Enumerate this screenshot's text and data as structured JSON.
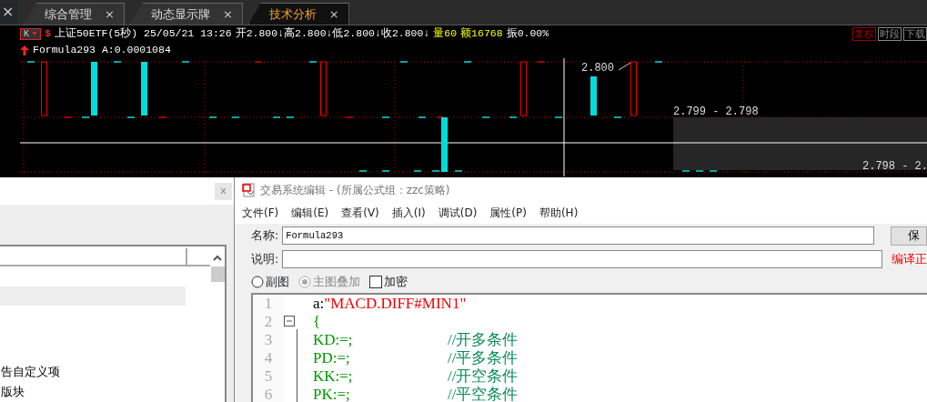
{
  "side_close": "×",
  "tabs": [
    {
      "label": "综合管理",
      "selected": false,
      "close": "×"
    },
    {
      "label": "动态显示牌",
      "selected": false,
      "close": "×"
    },
    {
      "label": "技术分析",
      "selected": true,
      "close": "×"
    }
  ],
  "quote": {
    "period_button": "K",
    "market_mark": "$",
    "segments": [
      {
        "text": "上证50ETF(5秒) 25/05/21 13:26"
      },
      {
        "text": "开2.800↓高2.800↓低2.800↓收2.800↓"
      },
      {
        "text": "量60",
        "color": "#ffff00"
      },
      {
        "text": "额16768",
        "color": "#ffff00"
      },
      {
        "text": "振0.00%"
      }
    ]
  },
  "indicator": {
    "text": "Formula293 A:0.0001084"
  },
  "chart_buttons": [
    {
      "label": "复权",
      "highlighted": true
    },
    {
      "label": "时段",
      "highlighted": false
    },
    {
      "label": "下载",
      "highlighted": false
    }
  ],
  "chart": {
    "price_label": "2.800",
    "range_labels": [
      "2.799 - 2.798",
      "2.798 - 2."
    ]
  },
  "left_panel": {
    "close_label": "x",
    "items": [
      "告自定义项",
      "版块"
    ]
  },
  "editor": {
    "title": "交易系统编辑 - (所属公式组：zzc策略)",
    "menu": [
      "文件(F)",
      "编辑(E)",
      "查看(V)",
      "插入(I)",
      "调试(D)",
      "属性(P)",
      "帮助(H)"
    ],
    "fields": [
      {
        "label": "名称:",
        "value": "Formula293"
      },
      {
        "label": "说明:"
      }
    ],
    "save_button": "保",
    "status": "编译正",
    "options": [
      {
        "kind": "radio",
        "label": "副图",
        "checked": false,
        "disabled": false
      },
      {
        "kind": "radio",
        "label": "主图叠加",
        "checked": true,
        "disabled": true
      },
      {
        "kind": "checkbox",
        "label": "加密",
        "checked": false,
        "disabled": false
      }
    ],
    "code_lines": [
      {
        "number": "1",
        "fold": false,
        "tokens": [
          {
            "text": "a:",
            "kind": "plain"
          },
          {
            "text": "\"MACD.DIFF#MIN1\"",
            "kind": "string"
          }
        ]
      },
      {
        "number": "2",
        "fold": true,
        "tokens": [
          {
            "text": "{",
            "kind": "code"
          }
        ]
      },
      {
        "number": "3",
        "fold": false,
        "tokens": [
          {
            "text": "KD:=;",
            "kind": "code"
          },
          {
            "text": "//开多条件",
            "kind": "comment"
          }
        ]
      },
      {
        "number": "4",
        "fold": false,
        "tokens": [
          {
            "text": "PD:=;",
            "kind": "code"
          },
          {
            "text": "//平多条件",
            "kind": "comment"
          }
        ]
      },
      {
        "number": "5",
        "fold": false,
        "tokens": [
          {
            "text": "KK:=;",
            "kind": "code"
          },
          {
            "text": "//开空条件",
            "kind": "comment"
          }
        ]
      },
      {
        "number": "6",
        "fold": false,
        "tokens": [
          {
            "text": "PK:=;",
            "kind": "code"
          },
          {
            "text": "//平空条件",
            "kind": "comment"
          }
        ]
      }
    ]
  }
}
